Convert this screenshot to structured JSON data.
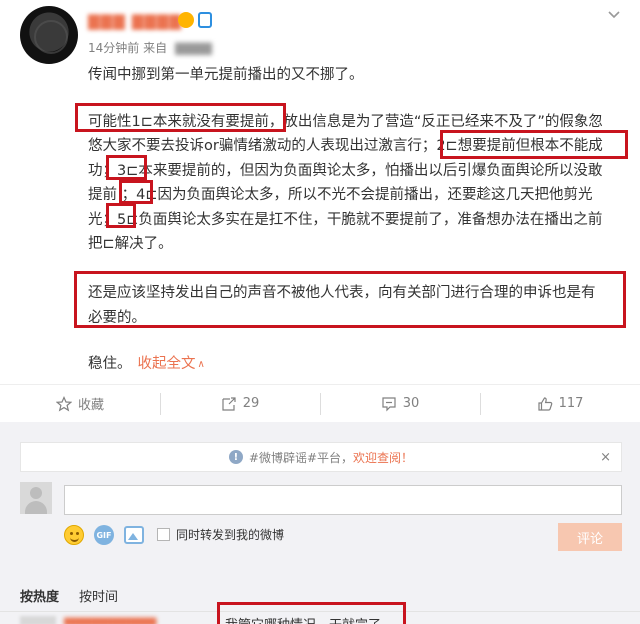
{
  "post": {
    "time": "14分钟前",
    "source_prefix": "来自",
    "lines": [
      "传闻中挪到第一单元提前播出的又不挪了。",
      "可能性1⊏本来就没有要提前，放出信息是为了营造“反正已经来不及了”的假象忽",
      "悠大家不要去投诉or骗情绪激动的人表现出过激言行；2⊏想要提前但根本不能成",
      "功；3⊏本来要提前的，但因为负面舆论太多，怕播出以后引爆负面舆论所以没敢",
      "提前 ；4⊏因为负面舆论太多，所以不光不会提前播出，还要趁这几天把他剪光",
      "光；5⊏负面舆论太多实在是扛不住，干脆就不要提前了，准备想办法在播出之前",
      "把⊏解决了。",
      "还是应该坚持发出自己的声音不被他人代表，向有关部门进行合理的申诉也是有",
      "必要的。"
    ],
    "closing": "稳住。",
    "collapse_link": "收起全文",
    "collapse_caret": "∧"
  },
  "actions": {
    "favorite_label": "收藏",
    "repost_count": "29",
    "comment_count": "30",
    "like_count": "117"
  },
  "comment_box": {
    "notice_text": "#微博辟谣#平台，",
    "notice_link": "欢迎查阅！",
    "notice_close": "×",
    "gif_label": "GIF",
    "repost_option": "同时转发到我的微博",
    "submit_label": "评论"
  },
  "sort": {
    "hot": "按热度",
    "time": "按时间"
  },
  "first_comment": {
    "text": "我管它哪种情况，干就完了。"
  },
  "colors": {
    "accent": "#eb7350",
    "highlight_box": "#c8141e"
  }
}
